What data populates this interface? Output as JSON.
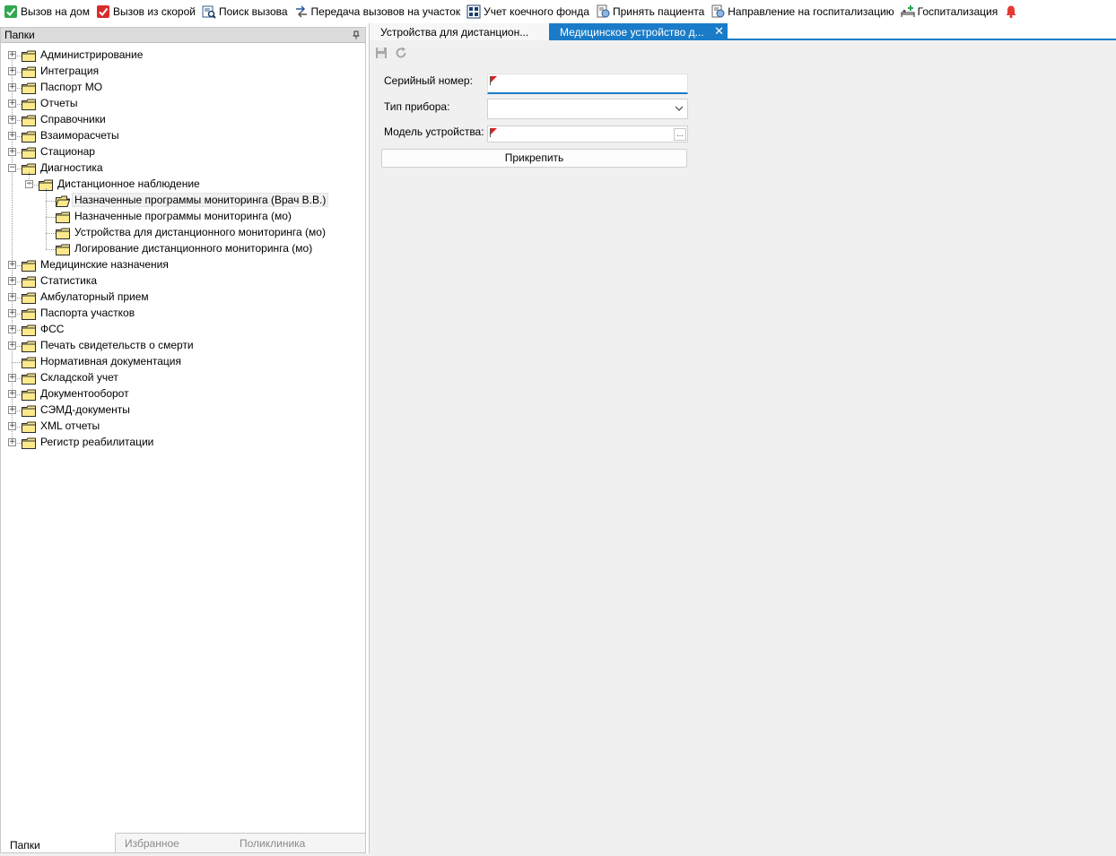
{
  "toolbar": {
    "items": [
      {
        "label": "Вызов на дом",
        "icon": "check-green-icon"
      },
      {
        "label": "Вызов из скорой",
        "icon": "check-red-icon"
      },
      {
        "label": "Поиск вызова",
        "icon": "search-call-icon"
      },
      {
        "label": "Передача вызовов на участок",
        "icon": "transfer-icon"
      },
      {
        "label": "Учет коечного фонда",
        "icon": "bed-fund-icon"
      },
      {
        "label": "Принять пациента",
        "icon": "accept-patient-icon"
      },
      {
        "label": "Направление на госпитализацию",
        "icon": "referral-icon"
      },
      {
        "label": "Госпитализация",
        "icon": "hospitalization-icon"
      }
    ],
    "notification_icon": "bell-icon",
    "colors": {
      "check_green": "#2fa84f",
      "check_red": "#d72b2b",
      "bell": "#e53935"
    }
  },
  "left_panel": {
    "title": "Папки",
    "pin_icon": "pin-icon",
    "tree": [
      {
        "label": "Администрирование",
        "level": 0,
        "expander": "plus"
      },
      {
        "label": "Интеграция",
        "level": 0,
        "expander": "plus"
      },
      {
        "label": "Паспорт МО",
        "level": 0,
        "expander": "plus"
      },
      {
        "label": "Отчеты",
        "level": 0,
        "expander": "plus"
      },
      {
        "label": "Справочники",
        "level": 0,
        "expander": "plus"
      },
      {
        "label": "Взаиморасчеты",
        "level": 0,
        "expander": "plus"
      },
      {
        "label": "Стационар",
        "level": 0,
        "expander": "plus"
      },
      {
        "label": "Диагностика",
        "level": 0,
        "expander": "minus"
      },
      {
        "label": "Дистанционное наблюдение",
        "level": 1,
        "expander": "minus"
      },
      {
        "label": "Назначенные программы мониторинга (Врач В.В.)",
        "level": 2,
        "expander": "none",
        "selected": true,
        "open": true
      },
      {
        "label": "Назначенные программы мониторинга (мо)",
        "level": 2,
        "expander": "none"
      },
      {
        "label": "Устройства для дистанционного мониторинга (мо)",
        "level": 2,
        "expander": "none"
      },
      {
        "label": "Логирование дистанционного мониторинга (мо)",
        "level": 2,
        "expander": "none"
      },
      {
        "label": "Медицинские назначения",
        "level": 0,
        "expander": "plus"
      },
      {
        "label": "Статистика",
        "level": 0,
        "expander": "plus"
      },
      {
        "label": "Амбулаторный прием",
        "level": 0,
        "expander": "plus"
      },
      {
        "label": "Паспорта участков",
        "level": 0,
        "expander": "plus"
      },
      {
        "label": "ФСС",
        "level": 0,
        "expander": "plus"
      },
      {
        "label": "Печать свидетельств о смерти",
        "level": 0,
        "expander": "plus"
      },
      {
        "label": "Нормативная документация",
        "level": 0,
        "expander": "none"
      },
      {
        "label": "Складской учет",
        "level": 0,
        "expander": "plus"
      },
      {
        "label": "Документооборот",
        "level": 0,
        "expander": "plus"
      },
      {
        "label": "СЭМД-документы",
        "level": 0,
        "expander": "plus"
      },
      {
        "label": "XML отчеты",
        "level": 0,
        "expander": "plus"
      },
      {
        "label": "Регистр реабилитации",
        "level": 0,
        "expander": "plus"
      }
    ],
    "bottom_tabs": [
      {
        "label": "Папки",
        "active": true
      },
      {
        "label": "Избранное",
        "active": false
      },
      {
        "label": "Поликлиника",
        "active": false
      }
    ]
  },
  "doc_tabs": [
    {
      "label": "Устройства для дистанцион...",
      "active": false
    },
    {
      "label": "Медицинское устройство д...",
      "active": true,
      "close_icon": "close-icon"
    }
  ],
  "form": {
    "toolbar_icons": [
      "save-icon",
      "refresh-icon"
    ],
    "serial_label": "Серийный номер:",
    "serial_value": "",
    "device_type_label": "Тип прибора:",
    "device_type_value": "",
    "device_model_label": "Модель устройства:",
    "device_model_value": "",
    "dots_label": "...",
    "attach_button": "Прикрепить",
    "accent_color": "#1a7cc8",
    "required_flag_color": "#e0201c"
  }
}
